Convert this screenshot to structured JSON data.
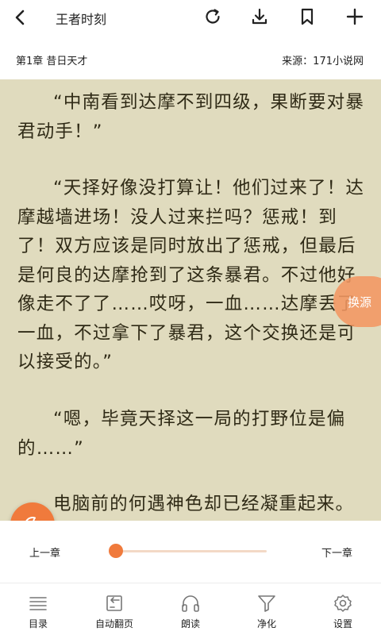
{
  "header": {
    "title": "王者时刻",
    "icons": [
      "back-arrow",
      "refresh",
      "download",
      "bookmark",
      "add"
    ]
  },
  "info": {
    "chapter": "第1章 昔日天才",
    "source": "来源：171小说网"
  },
  "content": {
    "paragraphs": [
      "“中南看到达摩不到四级，果断要对暴君动手！”",
      "“天择好像没打算让！他们过来了！达摩越墙进场！没人过来拦吗？惩戒！到了！双方应该是同时放出了惩戒，但最后是何良的达摩抢到了这条暴君。不过他好像走不了了……哎呀，一血……达摩丢了一血，不过拿下了暴君，这个交换还是可以接受的。”",
      "“嗯，毕竟天择这一局的打野位是偏的……”",
      "电脑前的何遇神色却已经凝重起来。"
    ],
    "switch_source": "换源"
  },
  "progress": {
    "prev_label": "上一章",
    "next_label": "下一章",
    "value": 0.0
  },
  "nav": {
    "items": [
      {
        "label": "目录",
        "icon": "list-icon"
      },
      {
        "label": "自动翻页",
        "icon": "auto-page-icon"
      },
      {
        "label": "朗读",
        "icon": "headphones-icon"
      },
      {
        "label": "净化",
        "icon": "filter-icon"
      },
      {
        "label": "设置",
        "icon": "gear-icon"
      }
    ]
  },
  "colors": {
    "accent": "#f07a3c",
    "reader_bg": "#e0dbbe",
    "text": "#2f2a16"
  }
}
